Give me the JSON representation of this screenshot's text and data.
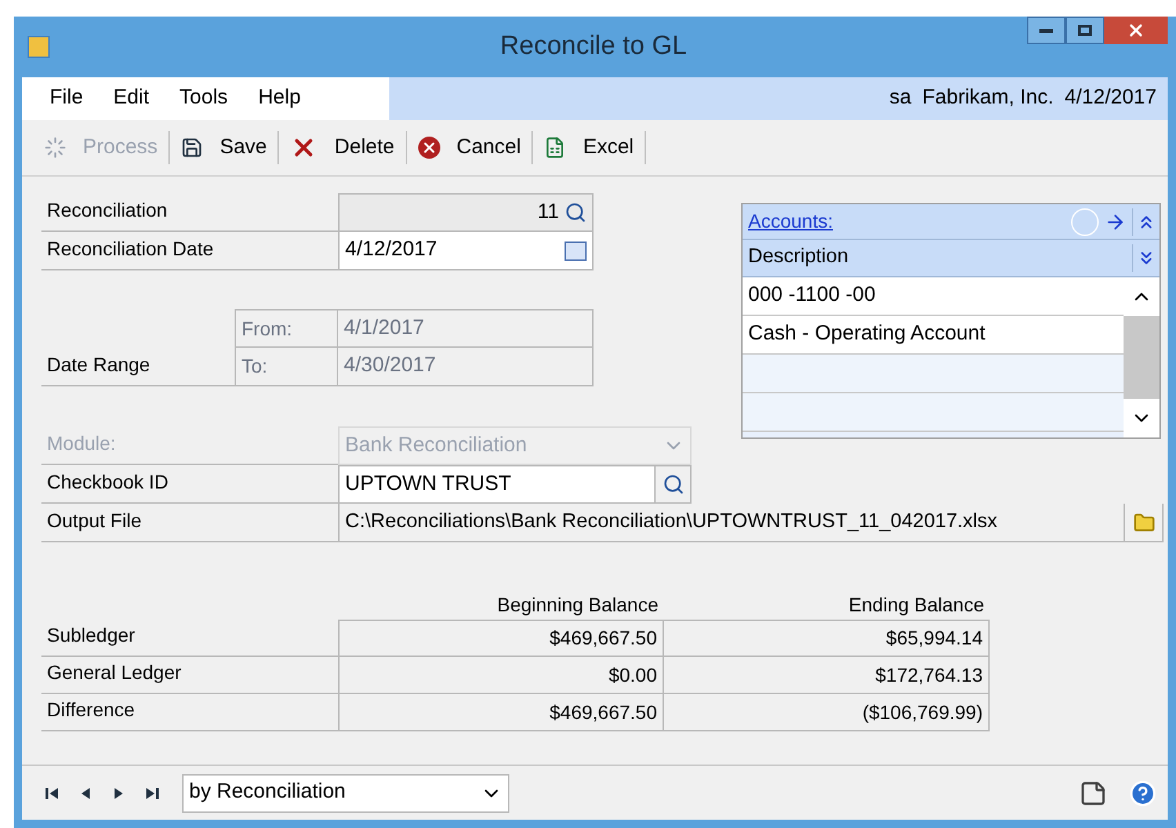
{
  "window": {
    "title": "Reconcile to GL"
  },
  "menu": [
    {
      "label": "File"
    },
    {
      "label": "Edit"
    },
    {
      "label": "Tools"
    },
    {
      "label": "Help"
    }
  ],
  "user_info": {
    "user": "sa",
    "company": "Fabrikam, Inc.",
    "date": "4/12/2017"
  },
  "toolbar": [
    {
      "kind": "process",
      "label": "Process",
      "disabled": true
    },
    {
      "kind": "save",
      "label": "Save",
      "disabled": false
    },
    {
      "kind": "delete",
      "label": "Delete",
      "disabled": false
    },
    {
      "kind": "cancel",
      "label": "Cancel",
      "disabled": false
    },
    {
      "kind": "excel",
      "label": "Excel",
      "disabled": false
    }
  ],
  "reconciliation": {
    "label": "Reconciliation",
    "value": "11"
  },
  "reconciliation_date": {
    "label": "Reconciliation Date",
    "value": "4/12/2017"
  },
  "date_range": {
    "label": "Date Range",
    "from_label": "From:",
    "from": "4/1/2017",
    "to_label": "To:",
    "to": "4/30/2017",
    "disabled": true
  },
  "module": {
    "label": "Module:",
    "value": "Bank Reconciliation",
    "disabled": true
  },
  "checkbook_id": {
    "label": "Checkbook ID",
    "value": "UPTOWN TRUST"
  },
  "output_file": {
    "label": "Output File",
    "value": "C:\\Reconciliations\\Bank Reconciliation\\UPTOWNTRUST_11_042017.xlsx"
  },
  "accounts": {
    "title": "Accounts:",
    "column": "Description",
    "rows": [
      "000 -1100 -00",
      "Cash - Operating Account"
    ]
  },
  "balances": {
    "columns": [
      "Beginning Balance",
      "Ending Balance"
    ],
    "rows": [
      {
        "label": "Subledger",
        "values": [
          "$469,667.50",
          "$65,994.14"
        ]
      },
      {
        "label": "General Ledger",
        "values": [
          "$0.00",
          "$172,764.13"
        ]
      },
      {
        "label": "Difference",
        "values": [
          "$469,667.50",
          "($106,769.99)"
        ]
      }
    ]
  },
  "browse": {
    "sort": "by Reconciliation"
  }
}
